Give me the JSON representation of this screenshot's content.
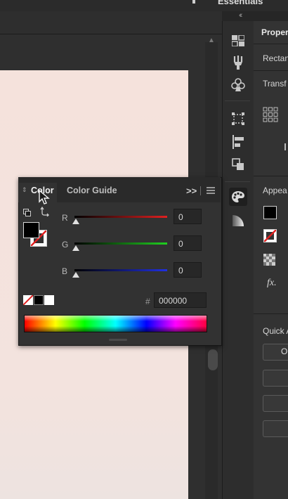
{
  "topbar": {
    "workspace_label": "Essentials",
    "collapse_icon": "double-chevron-left-icon"
  },
  "properties_panel": {
    "title": "Proper",
    "object_type": "Rectan",
    "transform_label": "Transf",
    "appearance_label": "Appea",
    "fx_label": "fx.",
    "quick_actions_label": "Quick A",
    "quick_btn_label": "O"
  },
  "color_panel": {
    "tabs": [
      {
        "label": "Color",
        "active": true
      },
      {
        "label": "Color Guide",
        "active": false
      }
    ],
    "expand_icon": ">>",
    "channels": [
      {
        "label": "R",
        "value": "0",
        "color": "#e02020"
      },
      {
        "label": "G",
        "value": "0",
        "color": "#20d020"
      },
      {
        "label": "B",
        "value": "0",
        "color": "#2030e0"
      }
    ],
    "hex_symbol": "#",
    "hex_value": "000000",
    "fill_color": "#000000"
  }
}
